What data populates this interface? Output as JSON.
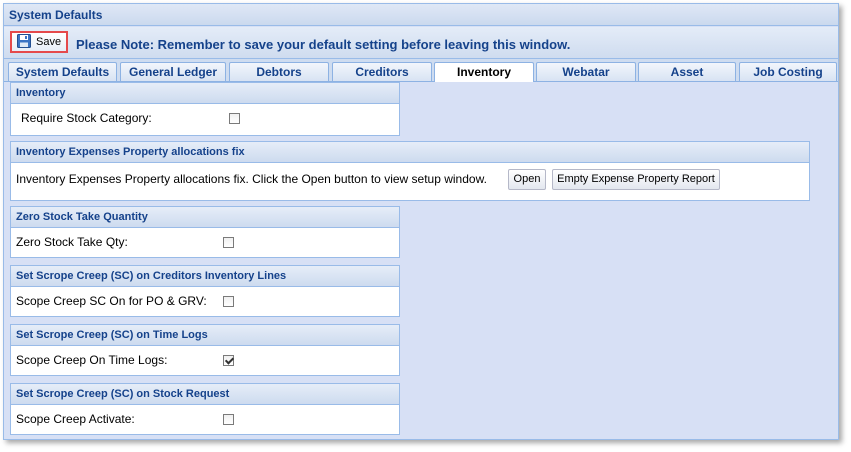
{
  "window": {
    "title": "System Defaults"
  },
  "toolbar": {
    "save_label": "Save",
    "note": "Please Note: Remember to save your default setting before leaving this window."
  },
  "tabs": [
    {
      "label": "System Defaults",
      "active": false
    },
    {
      "label": "General Ledger",
      "active": false
    },
    {
      "label": "Debtors",
      "active": false
    },
    {
      "label": "Creditors",
      "active": false
    },
    {
      "label": "Inventory",
      "active": true
    },
    {
      "label": "Webatar",
      "active": false
    },
    {
      "label": "Asset",
      "active": false
    },
    {
      "label": "Job Costing",
      "active": false
    }
  ],
  "sections": {
    "inventory": {
      "header": "Inventory",
      "label": "Require Stock Category:",
      "checked": false
    },
    "expenses": {
      "header": "Inventory Expenses Property allocations fix",
      "label": "Inventory Expenses Property allocations fix. Click the Open button to view setup window.",
      "open_label": "Open",
      "report_label": "Empty Expense Property Report"
    },
    "zero_stock": {
      "header": "Zero Stock Take Quantity",
      "label": "Zero Stock Take Qty:",
      "checked": false
    },
    "sc_creditors": {
      "header": "Set Scrope Creep (SC) on Creditors Inventory Lines",
      "label": "Scope Creep SC On for PO & GRV:",
      "checked": false
    },
    "sc_timelogs": {
      "header": "Set Scrope Creep (SC) on Time Logs",
      "label": "Scope Creep On Time Logs:",
      "checked": true
    },
    "sc_stock": {
      "header": "Set Scrope Creep (SC) on Stock Request",
      "label": "Scope Creep Activate:",
      "checked": false
    }
  }
}
